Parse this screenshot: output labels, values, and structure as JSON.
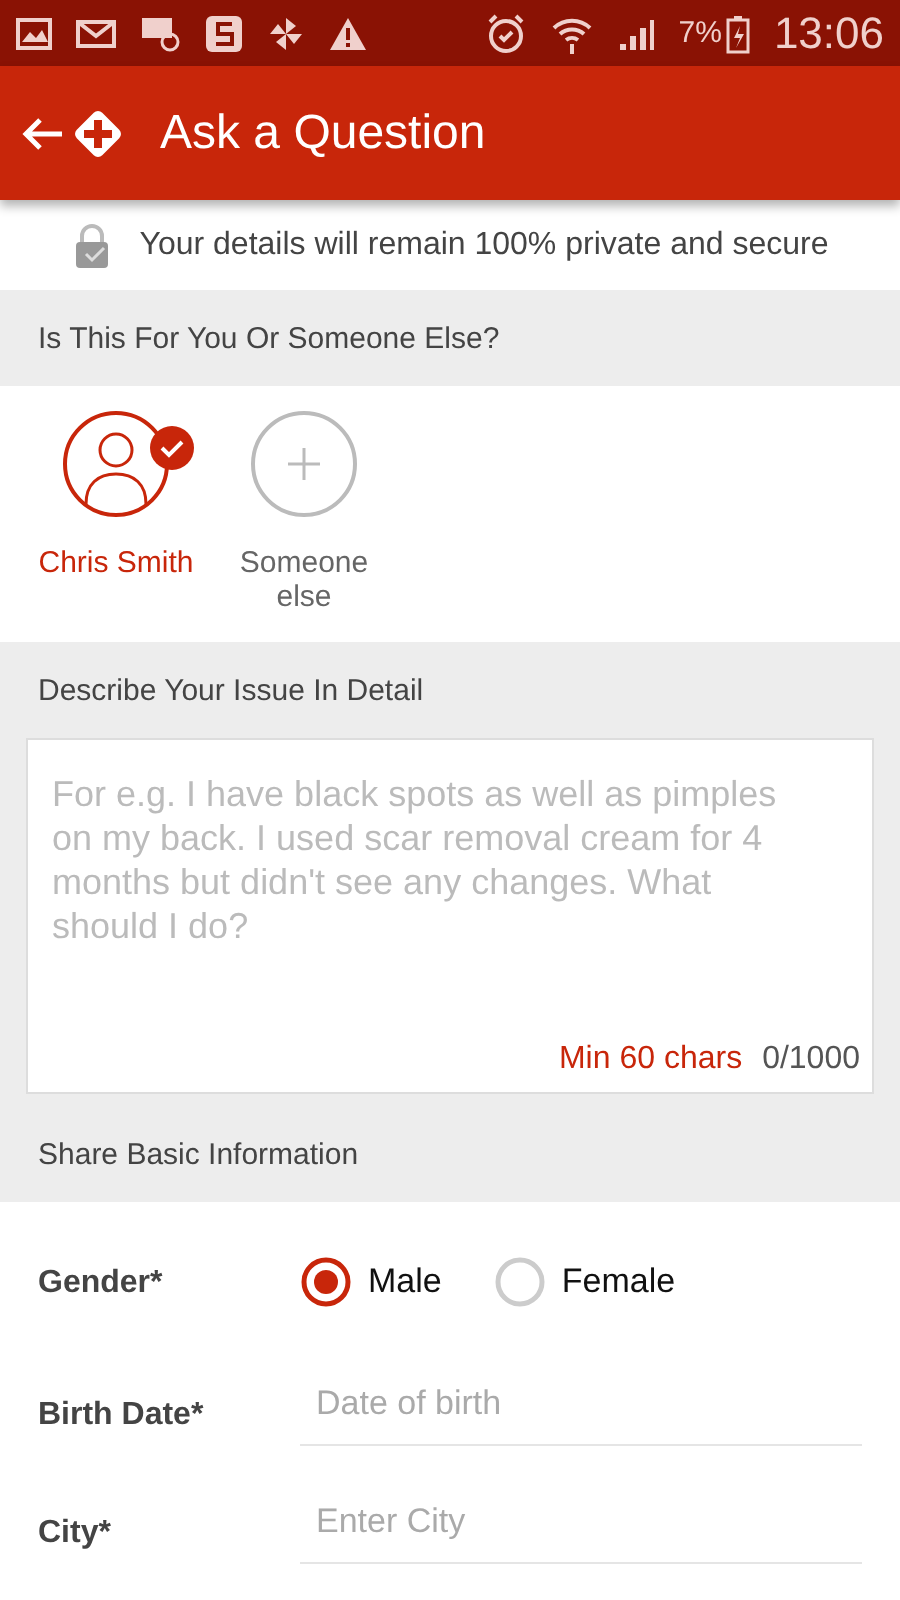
{
  "status_bar": {
    "battery": "7%",
    "time": "13:06"
  },
  "app_bar": {
    "title": "Ask a Question"
  },
  "privacy_note": "Your details will remain 100% private and secure",
  "patient_section": {
    "heading": "Is This For You Or Someone Else?",
    "options": [
      {
        "kind": "person",
        "label": "Chris Smith",
        "selected": true
      },
      {
        "kind": "add",
        "label": "Someone else",
        "selected": false
      }
    ]
  },
  "issue_section": {
    "heading": "Describe Your Issue In Detail",
    "placeholder": "For e.g. I have black spots as well as pimples on my back. I used scar removal cream for 4 months but didn't see any changes. What should I do?",
    "min_hint": "Min 60 chars",
    "counter": "0/1000"
  },
  "basic_info": {
    "heading": "Share Basic Information",
    "gender": {
      "label": "Gender*",
      "options": [
        {
          "label": "Male",
          "selected": true
        },
        {
          "label": "Female",
          "selected": false
        }
      ]
    },
    "fields": [
      {
        "label": "Birth Date*",
        "placeholder": "Date of birth"
      },
      {
        "label": "City*",
        "placeholder": "Enter City"
      }
    ]
  }
}
